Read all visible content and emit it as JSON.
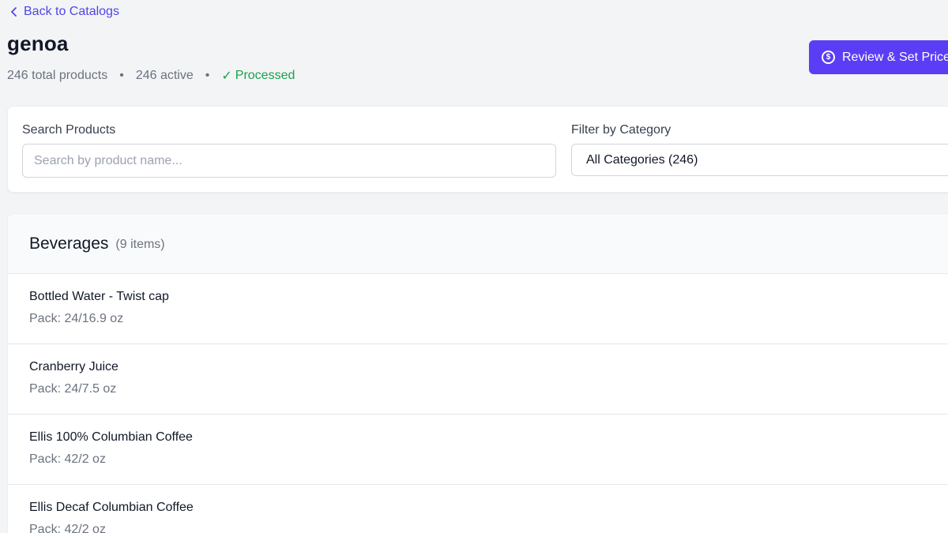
{
  "nav": {
    "back_label": "Back to Catalogs"
  },
  "catalog": {
    "title": "genoa",
    "total_products": "246 total products",
    "active": "246 active",
    "status": "Processed",
    "status_check": "✓"
  },
  "actions": {
    "review_label": "Review & Set Prices",
    "review_icon_glyph": "$"
  },
  "filters": {
    "search_label": "Search Products",
    "search_placeholder": "Search by product name...",
    "search_value": "",
    "category_label": "Filter by Category",
    "category_selected": "All Categories (246)"
  },
  "category": {
    "name": "Beverages",
    "count": "(9 items)",
    "products": [
      {
        "name": "Bottled Water - Twist cap",
        "pack": "Pack: 24/16.9 oz"
      },
      {
        "name": "Cranberry Juice",
        "pack": "Pack: 24/7.5 oz"
      },
      {
        "name": "Ellis 100% Columbian Coffee",
        "pack": "Pack: 42/2 oz"
      },
      {
        "name": "Ellis Decaf Columbian Coffee",
        "pack": "Pack: 42/2 oz"
      }
    ]
  },
  "colors": {
    "accent": "#5b3df5",
    "link": "#4f46e5",
    "status_success": "#16a34a",
    "background": "#f3f4f6"
  },
  "icons": {
    "back": "chevron-left-icon",
    "review": "dollar-circle-icon",
    "status": "check-icon"
  }
}
